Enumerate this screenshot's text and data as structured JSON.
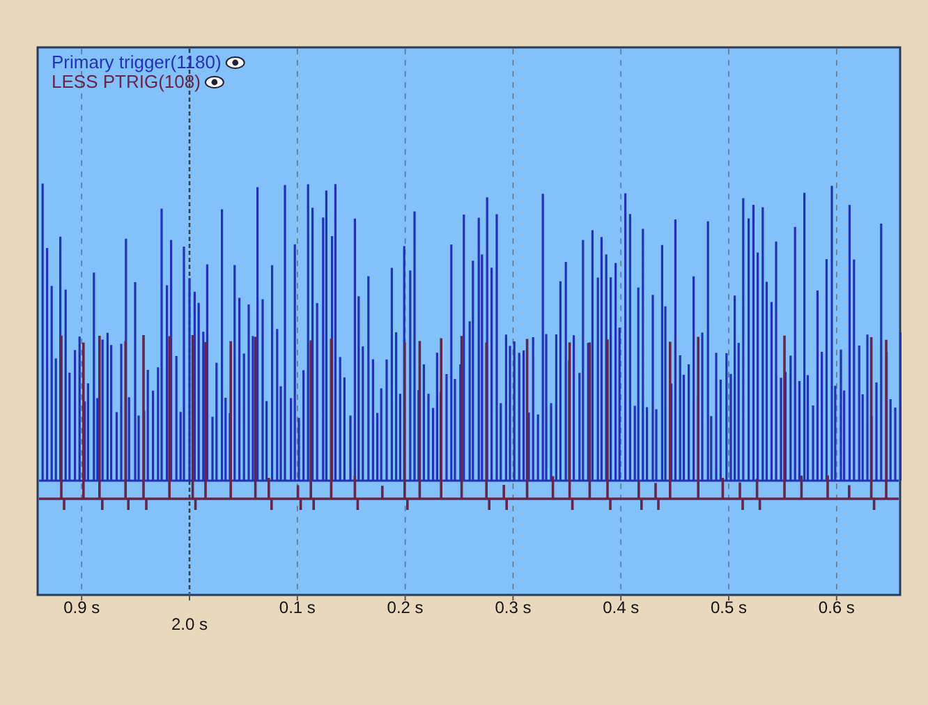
{
  "legend": [
    {
      "label": "Primary trigger(1180)",
      "color": "#2232b8"
    },
    {
      "label": "LESS PTRIG(108)",
      "color": "#6a2448"
    }
  ],
  "time_axis": [
    {
      "label": "0.9 s",
      "kind": "minor"
    },
    {
      "label": "2.0 s",
      "kind": "major"
    },
    {
      "label": "0.1 s",
      "kind": "minor"
    },
    {
      "label": "0.2 s",
      "kind": "minor"
    },
    {
      "label": "0.3 s",
      "kind": "minor"
    },
    {
      "label": "0.4 s",
      "kind": "minor"
    },
    {
      "label": "0.5 s",
      "kind": "minor"
    },
    {
      "label": "0.6 s",
      "kind": "minor"
    }
  ]
}
